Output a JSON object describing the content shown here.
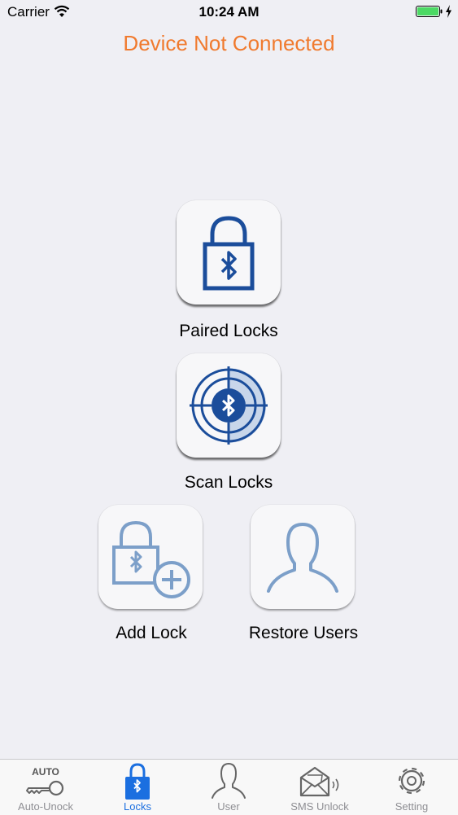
{
  "status_bar": {
    "carrier": "Carrier",
    "time": "10:24 AM"
  },
  "connection_status": "Device Not Connected",
  "actions": {
    "paired_locks": "Paired Locks",
    "scan_locks": "Scan Locks",
    "add_lock": "Add Lock",
    "restore_users": "Restore Users"
  },
  "tab_bar": {
    "items": [
      {
        "label": "Auto-Unock",
        "badge": "AUTO",
        "icon": "key-icon",
        "active": false
      },
      {
        "label": "Locks",
        "icon": "bluetooth-lock-icon",
        "active": true
      },
      {
        "label": "User",
        "icon": "user-icon",
        "active": false
      },
      {
        "label": "SMS Unlock",
        "icon": "envelope-icon",
        "active": false
      },
      {
        "label": "Setting",
        "icon": "gear-icon",
        "active": false
      }
    ]
  },
  "colors": {
    "warning": "#f07a2e",
    "icon_dark_blue": "#1b4d9b",
    "icon_light_blue": "#7c9fc9",
    "tab_active": "#1b6fe0",
    "tab_inactive": "#8e8e93",
    "background": "#efeff4"
  }
}
